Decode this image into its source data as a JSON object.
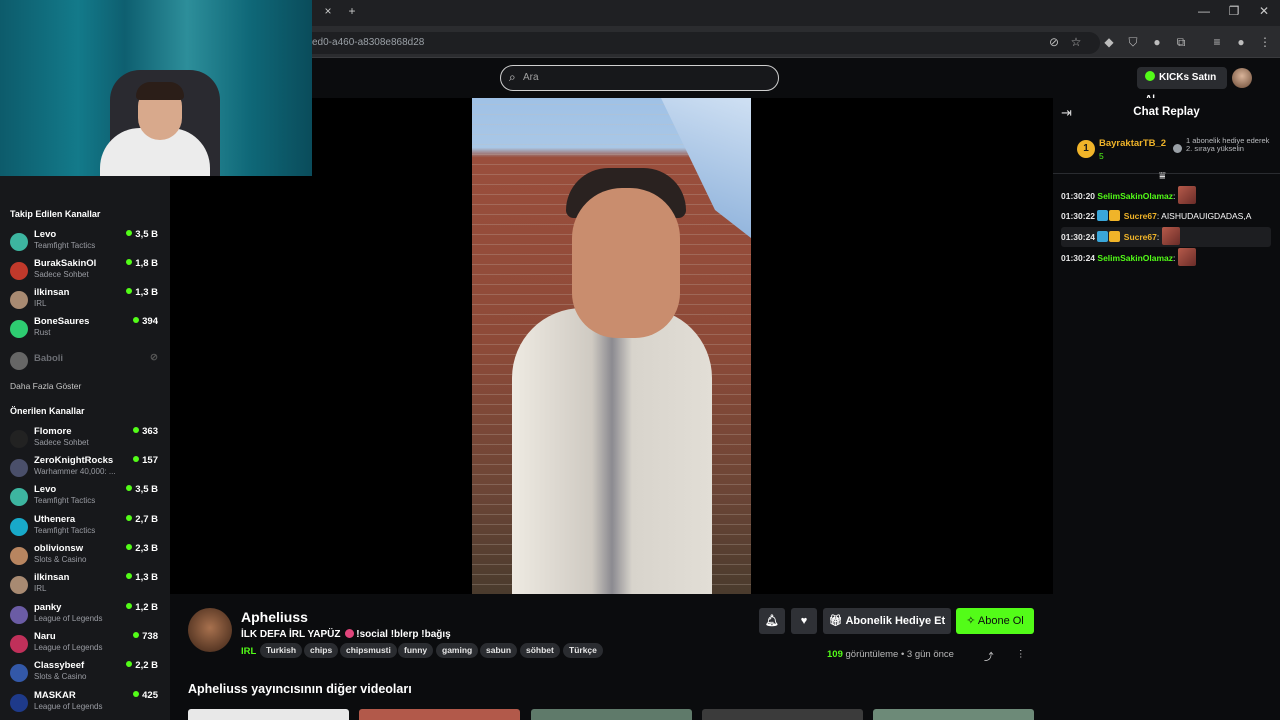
{
  "browser": {
    "url": "ed0-a460-a8308e868d28",
    "tab_close": "×",
    "tab_new": "+",
    "win_min": "—",
    "win_restore": "❐",
    "win_close": "✕"
  },
  "header": {
    "search_placeholder": "Ara",
    "kicks_label": "KICKs Satın Al"
  },
  "sidebar": {
    "followed_title": "Takip Edilen Kanallar",
    "followed": [
      {
        "name": "Levo",
        "category": "Teamfight Tactics",
        "viewers": "3,5 B"
      },
      {
        "name": "BurakSakinOl",
        "category": "Sadece Sohbet",
        "viewers": "1,8 B"
      },
      {
        "name": "ilkinsan",
        "category": "IRL",
        "viewers": "1,3 B"
      },
      {
        "name": "BoneSaures",
        "category": "Rust",
        "viewers": "394"
      },
      {
        "name": "Baboli",
        "category": "",
        "viewers": ""
      }
    ],
    "show_more": "Daha Fazla Göster",
    "recommended_title": "Önerilen Kanallar",
    "recommended": [
      {
        "name": "Flomore",
        "category": "Sadece Sohbet",
        "viewers": "363"
      },
      {
        "name": "ZeroKnightRocks",
        "category": "Warhammer 40,000: ...",
        "viewers": "157"
      },
      {
        "name": "Levo",
        "category": "Teamfight Tactics",
        "viewers": "3,5 B"
      },
      {
        "name": "Uthenera",
        "category": "Teamfight Tactics",
        "viewers": "2,7 B"
      },
      {
        "name": "oblivionsw",
        "category": "Slots & Casino",
        "viewers": "2,3 B"
      },
      {
        "name": "ilkinsan",
        "category": "IRL",
        "viewers": "1,3 B"
      },
      {
        "name": "panky",
        "category": "League of Legends",
        "viewers": "1,2 B"
      },
      {
        "name": "Naru",
        "category": "League of Legends",
        "viewers": "738"
      },
      {
        "name": "Classybeef",
        "category": "Slots & Casino",
        "viewers": "2,2 B"
      },
      {
        "name": "MASKAR",
        "category": "League of Legends",
        "viewers": "425"
      }
    ]
  },
  "video": {
    "channel": "Apheliuss",
    "title_part1": "İLK DEFA İRL YAPÜZ",
    "title_part2": "!social !blerp !bağış",
    "category": "IRL",
    "tags": [
      "Turkish",
      "chips",
      "chipsmusti",
      "funny",
      "gaming",
      "sabun",
      "söhbet",
      "Türkçe"
    ],
    "views_count": "109",
    "views_label": "görüntüleme",
    "separator": "•",
    "age": "3 gün önce",
    "gift_label": "Abonelik Hediye Et",
    "subscribe_label": "Abone Ol",
    "more_videos_title": "Apheliuss yayıncısının diğer videoları"
  },
  "chat": {
    "title": "Chat Replay",
    "pinned": {
      "rank": "1",
      "user": "BayraktarTB_2",
      "count": "5",
      "text": "1 abonelik hediye ederek 2. sıraya yükselin"
    },
    "messages": [
      {
        "time": "01:30:20",
        "user": "SelimSakinOlamaz",
        "text": "",
        "color": "#53fc18"
      },
      {
        "time": "01:30:22",
        "user": "Sucre67",
        "text": "AISHUDAUIGDADAS,A",
        "color": "#f0b429"
      },
      {
        "time": "01:30:24",
        "user": "Sucre67",
        "text": "",
        "color": "#f0b429"
      },
      {
        "time": "01:30:24",
        "user": "SelimSakinOlamaz",
        "text": "",
        "color": "#53fc18"
      }
    ]
  },
  "colors": {
    "accent": "#53fc18",
    "gold": "#f0b429",
    "background": "#0b0c0e",
    "sidebar": "#17181b"
  }
}
